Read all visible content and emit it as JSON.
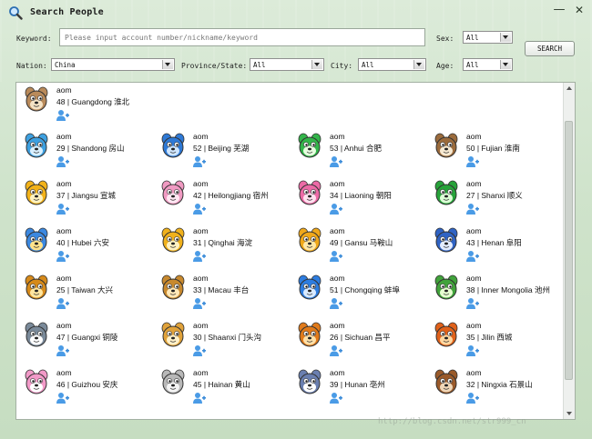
{
  "window": {
    "title": "Search People",
    "minimize_label": "—",
    "close_label": "✕"
  },
  "form": {
    "keyword_label": "Keyword:",
    "keyword_placeholder": "Please input account number/nickname/keyword",
    "sex_label": "Sex:",
    "sex_value": "All",
    "search_label": "SEARCH",
    "nation_label": "Nation:",
    "nation_value": "China",
    "province_label": "Province/State:",
    "province_value": "All",
    "city_label": "City:",
    "city_value": "All",
    "age_label": "Age:",
    "age_value": "All"
  },
  "results": [
    {
      "name": "aom",
      "info": "48 | Guangdong 淮北",
      "avatar": "dog-photo-avatar"
    },
    {
      "name": "aom",
      "info": "29 | Shandong 房山",
      "avatar": "dolphin-avatar"
    },
    {
      "name": "aom",
      "info": "52 | Beijing 芜湖",
      "avatar": "blue-dog-avatar"
    },
    {
      "name": "aom",
      "info": "53 | Anhui 合肥",
      "avatar": "frog-avatar"
    },
    {
      "name": "aom",
      "info": "50 | Fujian 淮南",
      "avatar": "beagle-avatar"
    },
    {
      "name": "aom",
      "info": "37 | Jiangsu 宣城",
      "avatar": "duck-avatar"
    },
    {
      "name": "aom",
      "info": "42 | Heilongjiang 宿州",
      "avatar": "rabbit-avatar"
    },
    {
      "name": "aom",
      "info": "34 | Liaoning 朝阳",
      "avatar": "pig-avatar"
    },
    {
      "name": "aom",
      "info": "27 | Shanxi 顺义",
      "avatar": "green-frog-avatar"
    },
    {
      "name": "aom",
      "info": "40 | Hubei 六安",
      "avatar": "blue-rabbit-avatar"
    },
    {
      "name": "aom",
      "info": "31 | Qinghai 海淀",
      "avatar": "giraffe-avatar"
    },
    {
      "name": "aom",
      "info": "49 | Gansu 马鞍山",
      "avatar": "lion-avatar"
    },
    {
      "name": "aom",
      "info": "43 | Henan 阜阳",
      "avatar": "wolf-avatar"
    },
    {
      "name": "aom",
      "info": "25 | Taiwan 大兴",
      "avatar": "tiger-avatar"
    },
    {
      "name": "aom",
      "info": "33 | Macau 丰台",
      "avatar": "bear-avatar"
    },
    {
      "name": "aom",
      "info": "51 | Chongqing 蚌埠",
      "avatar": "hippo-avatar"
    },
    {
      "name": "aom",
      "info": "38 | Inner Mongolia 池州",
      "avatar": "mallard-avatar"
    },
    {
      "name": "aom",
      "info": "47 | Guangxi 铜陵",
      "avatar": "raccoon-avatar"
    },
    {
      "name": "aom",
      "info": "30 | Shaanxi 门头沟",
      "avatar": "monkey-avatar"
    },
    {
      "name": "aom",
      "info": "26 | Sichuan 昌平",
      "avatar": "cow-avatar"
    },
    {
      "name": "aom",
      "info": "35 | Jilin 西城",
      "avatar": "orange-tiger-avatar"
    },
    {
      "name": "aom",
      "info": "46 | Guizhou 安庆",
      "avatar": "pink-cat-avatar"
    },
    {
      "name": "aom",
      "info": "45 | Hainan 黄山",
      "avatar": "white-cat-photo-avatar"
    },
    {
      "name": "aom",
      "info": "39 | Hunan 亳州",
      "avatar": "mouse-avatar"
    },
    {
      "name": "aom",
      "info": "32 | Ningxia 石景山",
      "avatar": "beaver-avatar"
    }
  ],
  "add_friend_icon": "add-friend-icon",
  "watermark": "http://blog.csdn.net/str999_cn",
  "colors": {
    "accent_blue": "#3c8fd8",
    "window_bg": "#d4e6d0",
    "results_bg": "#ffffff"
  }
}
